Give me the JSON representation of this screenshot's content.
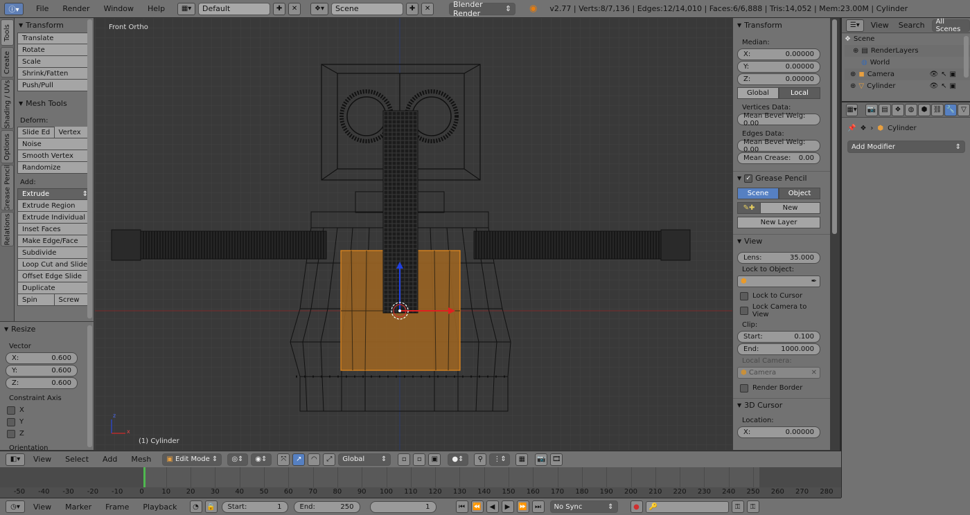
{
  "topbar": {
    "menus": [
      "File",
      "Render",
      "Window",
      "Help"
    ],
    "layout": "Default",
    "scene": "Scene",
    "engine": "Blender Render",
    "stats": "v2.77 | Verts:8/7,136 | Edges:12/14,010 | Faces:6/6,888 | Tris:14,052 | Mem:23.00M | Cylinder"
  },
  "vtabs": [
    "Tools",
    "Create",
    "Shading / UVs",
    "Options",
    "Grease Pencil",
    "Relations"
  ],
  "tools": {
    "transform_title": "Transform",
    "transform": [
      "Translate",
      "Rotate",
      "Scale",
      "Shrink/Fatten",
      "Push/Pull"
    ],
    "mesh_tools_title": "Mesh Tools",
    "deform_label": "Deform:",
    "slide_edge": "Slide Ed",
    "vertex": "Vertex",
    "deform": [
      "Noise",
      "Smooth Vertex",
      "Randomize"
    ],
    "add_label": "Add:",
    "extrude": "Extrude",
    "add": [
      "Extrude Region",
      "Extrude Individual",
      "Inset Faces",
      "Make Edge/Face",
      "Subdivide",
      "Loop Cut and Slide",
      "Offset Edge Slide",
      "Duplicate"
    ],
    "spin": "Spin",
    "screw": "Screw"
  },
  "resize": {
    "title": "Resize",
    "vector_label": "Vector",
    "x_label": "X:",
    "x": "0.600",
    "y_label": "Y:",
    "y": "0.600",
    "z_label": "Z:",
    "z": "0.600",
    "constraint_label": "Constraint Axis",
    "axes": [
      "X",
      "Y",
      "Z"
    ],
    "orientation_label": "Orientation"
  },
  "viewport": {
    "view_name": "Front Ortho",
    "object_label": "(1) Cylinder",
    "axis_z": "z",
    "axis_x": "x"
  },
  "npanel": {
    "transform_title": "Transform",
    "median_label": "Median:",
    "x_label": "X:",
    "x": "0.00000",
    "y_label": "Y:",
    "y": "0.00000",
    "z_label": "Z:",
    "z": "0.00000",
    "global": "Global",
    "local": "Local",
    "vertices_data": "Vertices Data:",
    "mean_bevel_v": "Mean Bevel Weig: 0.00",
    "edges_data": "Edges Data:",
    "mean_bevel_e": "Mean Bevel Weig: 0.00",
    "mean_crease_label": "Mean Crease:",
    "mean_crease": "0.00",
    "grease_title": "Grease Pencil",
    "gp_scene": "Scene",
    "gp_object": "Object",
    "gp_new": "New",
    "gp_new_layer": "New Layer",
    "view_title": "View",
    "lens_label": "Lens:",
    "lens": "35.000",
    "lock_object_label": "Lock to Object:",
    "lock_cursor": "Lock to Cursor",
    "lock_camera": "Lock Camera to View",
    "clip_label": "Clip:",
    "clip_start_label": "Start:",
    "clip_start": "0.100",
    "clip_end_label": "End:",
    "clip_end": "1000.000",
    "local_camera_label": "Local Camera:",
    "local_camera": "Camera",
    "render_border": "Render Border",
    "cursor_title": "3D Cursor",
    "location_label": "Location:",
    "cursor_x_label": "X:",
    "cursor_x": "0.00000"
  },
  "outliner": {
    "view": "View",
    "search": "Search",
    "all_scenes": "All Scenes",
    "items": [
      "Scene",
      "RenderLayers",
      "World",
      "Camera",
      "Cylinder"
    ]
  },
  "properties": {
    "object_name": "Cylinder",
    "add_modifier": "Add Modifier"
  },
  "view3d_header": {
    "menus": [
      "View",
      "Select",
      "Add",
      "Mesh"
    ],
    "mode": "Edit Mode",
    "orientation": "Global"
  },
  "timeline": {
    "ticks": [
      "-50",
      "-40",
      "-30",
      "-20",
      "-10",
      "0",
      "10",
      "20",
      "30",
      "40",
      "50",
      "60",
      "70",
      "80",
      "90",
      "100",
      "110",
      "120",
      "130",
      "140",
      "150",
      "160",
      "170",
      "180",
      "190",
      "200",
      "210",
      "220",
      "230",
      "240",
      "250",
      "260",
      "270",
      "280"
    ],
    "menus": [
      "View",
      "Marker",
      "Frame",
      "Playback"
    ],
    "start_label": "Start:",
    "start": "1",
    "end_label": "End:",
    "end": "250",
    "current": "1",
    "sync": "No Sync"
  }
}
